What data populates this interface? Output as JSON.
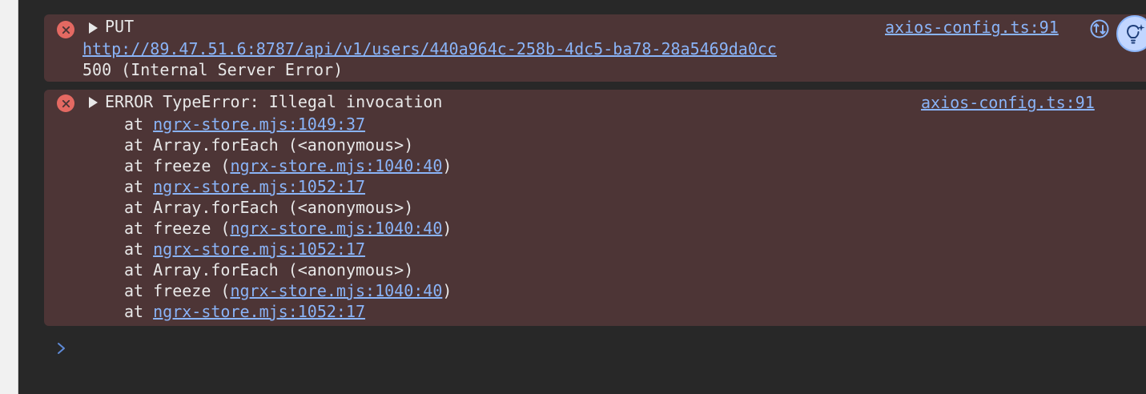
{
  "console": {
    "entries": [
      {
        "level": "error",
        "method": "PUT",
        "url": "http://89.47.51.6:8787/api/v1/users/440a964c-258b-4dc5-ba78-28a5469da0cc",
        "status": "500 (Internal Server Error)",
        "source": "axios-config.ts:91"
      },
      {
        "level": "error",
        "message": "ERROR TypeError: Illegal invocation",
        "source": "axios-config.ts:91",
        "stack": [
          {
            "prefix": "at ",
            "fn": "",
            "link": "ngrx-store.mjs:1049:37",
            "suffix": ""
          },
          {
            "prefix": "at Array.forEach (<anonymous>)",
            "fn": "",
            "link": "",
            "suffix": ""
          },
          {
            "prefix": "at freeze (",
            "fn": "",
            "link": "ngrx-store.mjs:1040:40",
            "suffix": ")"
          },
          {
            "prefix": "at ",
            "fn": "",
            "link": "ngrx-store.mjs:1052:17",
            "suffix": ""
          },
          {
            "prefix": "at Array.forEach (<anonymous>)",
            "fn": "",
            "link": "",
            "suffix": ""
          },
          {
            "prefix": "at freeze (",
            "fn": "",
            "link": "ngrx-store.mjs:1040:40",
            "suffix": ")"
          },
          {
            "prefix": "at ",
            "fn": "",
            "link": "ngrx-store.mjs:1052:17",
            "suffix": ""
          },
          {
            "prefix": "at Array.forEach (<anonymous>)",
            "fn": "",
            "link": "",
            "suffix": ""
          },
          {
            "prefix": "at freeze (",
            "fn": "",
            "link": "ngrx-store.mjs:1040:40",
            "suffix": ")"
          },
          {
            "prefix": "at ",
            "fn": "",
            "link": "ngrx-store.mjs:1052:17",
            "suffix": ""
          }
        ]
      }
    ],
    "icons": {
      "error": "error-circle-icon",
      "expand": "expand-triangle-icon",
      "sync": "sync-icon",
      "ai": "ai-insight-lightbulb-icon",
      "prompt": "chevron-right-icon"
    },
    "colors": {
      "background": "#282828",
      "error_row": "#4d3536",
      "error_icon": "#e46962",
      "link": "#8ab4f8",
      "text": "#e8e8e8",
      "ai_button": "#c2d6ff"
    }
  }
}
